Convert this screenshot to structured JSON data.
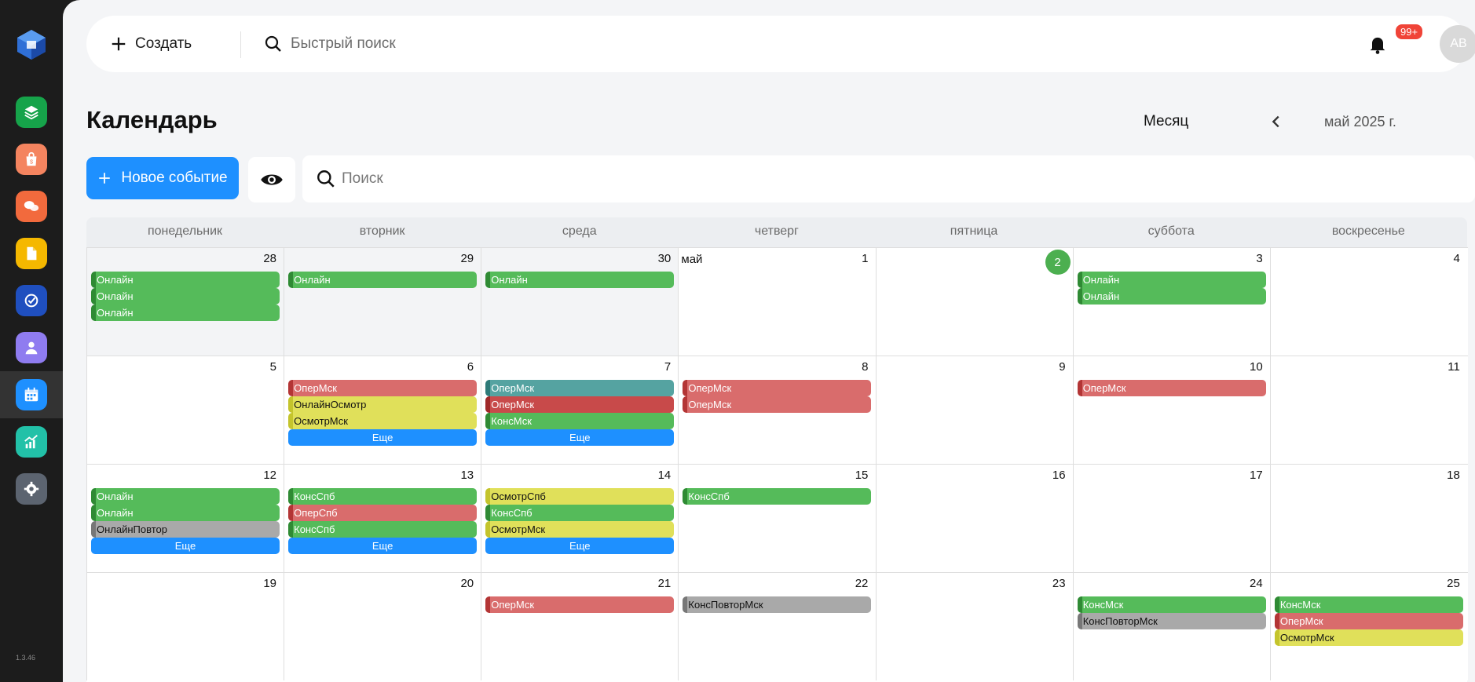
{
  "app": {
    "version": "1.3.46"
  },
  "header": {
    "create_label": "Создать",
    "quick_search_placeholder": "Быстрый поиск",
    "notifications_badge": "99+",
    "avatar_initials": "AB"
  },
  "page": {
    "title": "Календарь",
    "view_mode": "Месяц",
    "month_label": "май 2025 г."
  },
  "toolbar": {
    "new_event_label": "Новое событие",
    "search_placeholder": "Поиск"
  },
  "calendar": {
    "weekdays": [
      "понедельник",
      "вторник",
      "среда",
      "четверг",
      "пятница",
      "суббота",
      "воскресенье"
    ],
    "weeks": [
      [
        {
          "day": "28",
          "other": true,
          "events": [
            {
              "label": "Онлайн",
              "color": "green"
            },
            {
              "label": "Онлайн",
              "color": "green"
            },
            {
              "label": "Онлайн",
              "color": "green"
            }
          ]
        },
        {
          "day": "29",
          "other": true,
          "events": [
            {
              "label": "Онлайн",
              "color": "green"
            }
          ]
        },
        {
          "day": "30",
          "other": true,
          "events": [
            {
              "label": "Онлайн",
              "color": "green"
            }
          ]
        },
        {
          "day": "1",
          "month": "май",
          "events": []
        },
        {
          "day": "2",
          "today": true,
          "events": []
        },
        {
          "day": "3",
          "events": [
            {
              "label": "Онлайн",
              "color": "green"
            },
            {
              "label": "Онлайн",
              "color": "green"
            }
          ]
        },
        {
          "day": "4",
          "events": []
        }
      ],
      [
        {
          "day": "5",
          "events": []
        },
        {
          "day": "6",
          "events": [
            {
              "label": "ОперМск",
              "color": "red"
            },
            {
              "label": "ОнлайнОсмотр",
              "color": "yellow"
            },
            {
              "label": "ОсмотрМск",
              "color": "yellow"
            },
            {
              "label": "Еще",
              "color": "more"
            }
          ]
        },
        {
          "day": "7",
          "events": [
            {
              "label": "ОперМск",
              "color": "teal"
            },
            {
              "label": "ОперМск",
              "color": "darkred"
            },
            {
              "label": "КонсМск",
              "color": "green"
            },
            {
              "label": "Еще",
              "color": "more"
            }
          ]
        },
        {
          "day": "8",
          "events": [
            {
              "label": "ОперМск",
              "color": "red"
            },
            {
              "label": "ОперМск",
              "color": "red"
            }
          ]
        },
        {
          "day": "9",
          "events": []
        },
        {
          "day": "10",
          "events": [
            {
              "label": "ОперМск",
              "color": "red"
            }
          ]
        },
        {
          "day": "11",
          "events": []
        }
      ],
      [
        {
          "day": "12",
          "events": [
            {
              "label": "Онлайн",
              "color": "green"
            },
            {
              "label": "Онлайн",
              "color": "green"
            },
            {
              "label": "ОнлайнПовтор",
              "color": "gray"
            },
            {
              "label": "Еще",
              "color": "more"
            }
          ]
        },
        {
          "day": "13",
          "events": [
            {
              "label": "КонсСпб",
              "color": "green"
            },
            {
              "label": "ОперСпб",
              "color": "red"
            },
            {
              "label": "КонсСпб",
              "color": "green"
            },
            {
              "label": "Еще",
              "color": "more"
            }
          ]
        },
        {
          "day": "14",
          "events": [
            {
              "label": "ОсмотрСпб",
              "color": "yellow"
            },
            {
              "label": "КонсСпб",
              "color": "green"
            },
            {
              "label": "ОсмотрМск",
              "color": "yellow"
            },
            {
              "label": "Еще",
              "color": "more"
            }
          ]
        },
        {
          "day": "15",
          "events": [
            {
              "label": "КонсСпб",
              "color": "green"
            }
          ]
        },
        {
          "day": "16",
          "events": []
        },
        {
          "day": "17",
          "events": []
        },
        {
          "day": "18",
          "events": []
        }
      ],
      [
        {
          "day": "19",
          "events": []
        },
        {
          "day": "20",
          "events": []
        },
        {
          "day": "21",
          "events": [
            {
              "label": "ОперМск",
              "color": "red"
            }
          ]
        },
        {
          "day": "22",
          "events": [
            {
              "label": "КонсПовторМск",
              "color": "gray"
            }
          ]
        },
        {
          "day": "23",
          "events": []
        },
        {
          "day": "24",
          "events": [
            {
              "label": "КонсМск",
              "color": "green"
            },
            {
              "label": "КонсПовторМск",
              "color": "gray"
            }
          ]
        },
        {
          "day": "25",
          "events": [
            {
              "label": "КонсМск",
              "color": "green"
            },
            {
              "label": "ОперМск",
              "color": "red"
            },
            {
              "label": "ОсмотрМск",
              "color": "yellow"
            }
          ]
        }
      ]
    ]
  }
}
